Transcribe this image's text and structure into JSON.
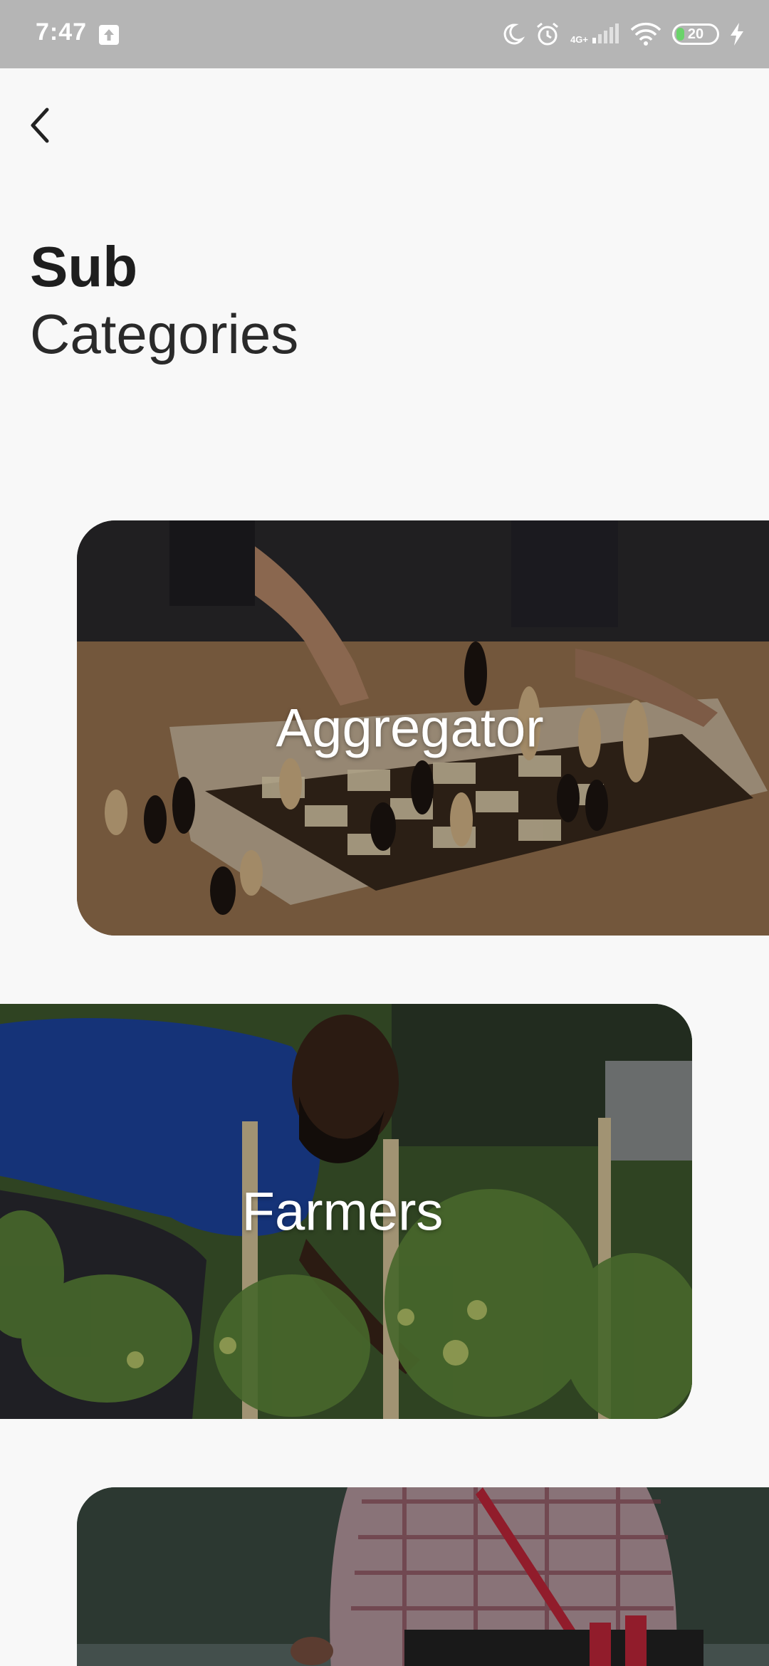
{
  "status_bar": {
    "time": "7:47",
    "network_label_top": "4G+",
    "battery_level": "20",
    "battery_fraction": 0.2
  },
  "header": {
    "title_line1": "Sub",
    "title_line2": "Categories"
  },
  "categories": [
    {
      "label": "Aggregator",
      "image": "chess-board-image"
    },
    {
      "label": "Farmers",
      "image": "farmer-in-garden-image"
    },
    {
      "label": "",
      "image": "market-vendor-image"
    }
  ],
  "colors": {
    "status_bar_bg": "#b5b5b5",
    "page_bg": "#f8f8f8",
    "title_text": "#1e1e1e",
    "card_label_text": "#ffffff",
    "battery_fill": "#6ad36a"
  }
}
